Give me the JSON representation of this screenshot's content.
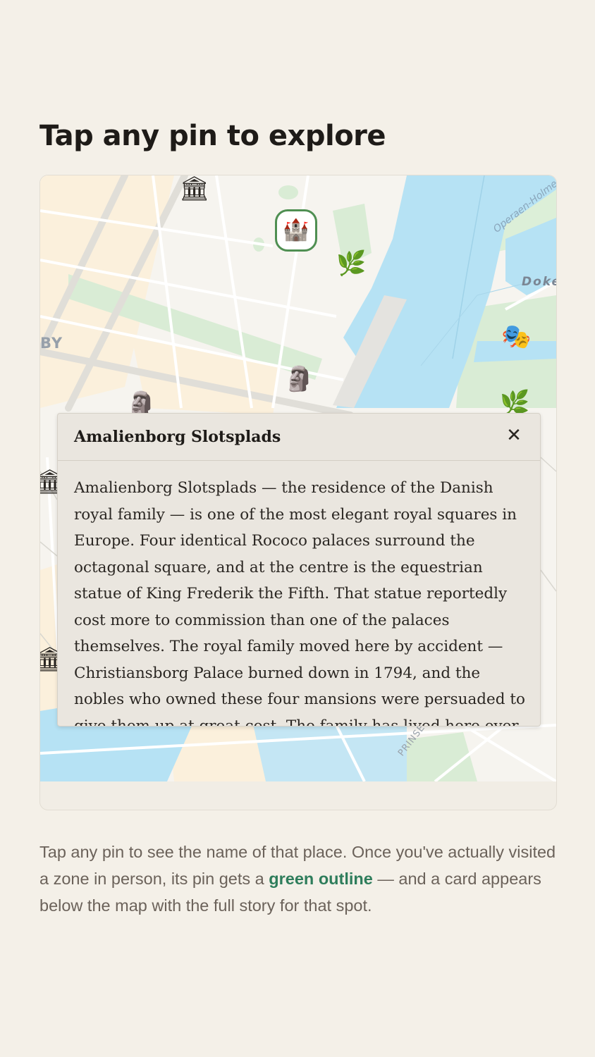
{
  "page": {
    "title": "Tap any pin to explore"
  },
  "map": {
    "labels": {
      "district": "BY",
      "dokken": "Doke",
      "operaen": "Operaen-Holme",
      "prins": "PRINSE"
    },
    "pins": [
      {
        "name": "town-hall",
        "glyph": "🏛"
      },
      {
        "name": "castle",
        "glyph": "🏰",
        "visited": true
      },
      {
        "name": "park",
        "glyph": "🌿"
      },
      {
        "name": "theatre",
        "glyph": "🎭"
      },
      {
        "name": "statue",
        "glyph": "🗿"
      },
      {
        "name": "statue-2",
        "glyph": "🗿"
      },
      {
        "name": "park-2",
        "glyph": "🌿"
      },
      {
        "name": "museum",
        "glyph": "🏛"
      },
      {
        "name": "museum-2",
        "glyph": "🏛"
      }
    ]
  },
  "popup": {
    "title": "Amalienborg Slotsplads",
    "close_glyph": "✕",
    "body": "Amalienborg Slotsplads — the residence of the Danish royal family — is one of the most elegant royal squares in Europe. Four identical Rococo palaces surround the octagonal square, and at the centre is the equestrian statue of King Frederik the Fifth. That statue reportedly cost more to commission than one of the palaces themselves. The royal family moved here by accident — Christiansborg Palace burned down in 1794, and the nobles who owned these four mansions were persuaded to give them up at great cost. The family has lived here ever"
  },
  "caption": {
    "part1": "Tap any pin to see the name of that place. Once you've actually visited a zone in person, its pin gets a ",
    "highlight": "green outline",
    "part2": " — and a card appears below the map with the full story for that spot."
  },
  "colors": {
    "background": "#f4f0e8",
    "water": "#b6e2f4",
    "park": "#d9ecd5",
    "visited_outline": "#4f8f52",
    "highlight_text": "#2e7d5b"
  }
}
